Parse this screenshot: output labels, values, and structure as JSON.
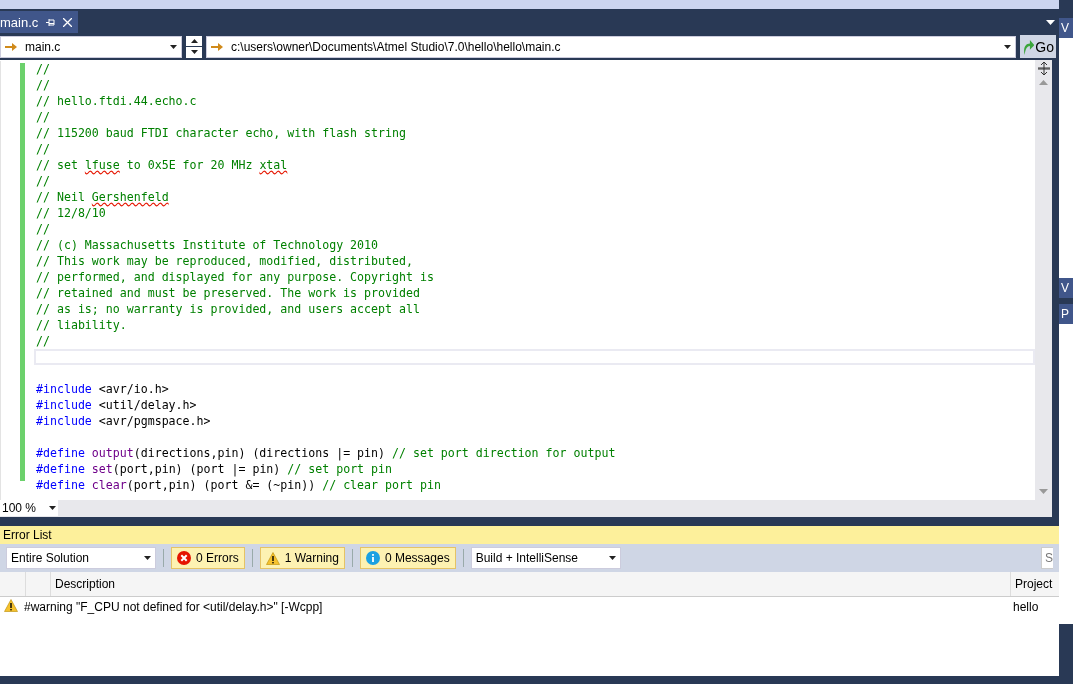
{
  "tab": {
    "label": "main.c",
    "selected": true
  },
  "nav": {
    "file": "main.c",
    "path": "c:\\users\\owner\\Documents\\Atmel Studio\\7.0\\hello\\hello\\main.c",
    "go": "Go"
  },
  "editor": {
    "blocks": [
      {
        "current_line_after": true,
        "lines": [
          [
            {
              "t": "//",
              "kind": "comment"
            }
          ],
          [
            {
              "t": "//",
              "kind": "comment"
            }
          ],
          [
            {
              "t": "// hello.ftdi.44.echo.c",
              "kind": "comment"
            }
          ],
          [
            {
              "t": "//",
              "kind": "comment"
            }
          ],
          [
            {
              "t": "// 115200 baud FTDI character echo, with flash string",
              "kind": "comment"
            }
          ],
          [
            {
              "t": "//",
              "kind": "comment"
            }
          ],
          [
            {
              "t": "// set ",
              "kind": "comment"
            },
            {
              "t": "lfuse",
              "kind": "misspelled"
            },
            {
              "t": " to 0x5E for 20 MHz ",
              "kind": "comment"
            },
            {
              "t": "xtal",
              "kind": "misspelled"
            }
          ],
          [
            {
              "t": "//",
              "kind": "comment"
            }
          ],
          [
            {
              "t": "// Neil ",
              "kind": "comment"
            },
            {
              "t": "Gershenfeld",
              "kind": "misspelled"
            }
          ],
          [
            {
              "t": "// 12/8/10",
              "kind": "comment"
            }
          ],
          [
            {
              "t": "//",
              "kind": "comment"
            }
          ],
          [
            {
              "t": "// (c) Massachusetts Institute of Technology 2010",
              "kind": "comment"
            }
          ],
          [
            {
              "t": "// This work may be reproduced, modified, distributed,",
              "kind": "comment"
            }
          ],
          [
            {
              "t": "// performed, and displayed for any purpose. Copyright is",
              "kind": "comment"
            }
          ],
          [
            {
              "t": "// retained and must be preserved. The work is provided",
              "kind": "comment"
            }
          ],
          [
            {
              "t": "// as is; no warranty is provided, and users accept all",
              "kind": "comment"
            }
          ],
          [
            {
              "t": "// liability.",
              "kind": "comment"
            }
          ],
          [
            {
              "t": "//",
              "kind": "comment"
            }
          ]
        ]
      },
      {
        "current_line_after": false,
        "lines": [
          [
            {
              "t": "#include",
              "kind": "directive"
            },
            {
              "t": " <avr/io.h>",
              "kind": "plain"
            }
          ],
          [
            {
              "t": "#include",
              "kind": "directive"
            },
            {
              "t": " <util/delay.h>",
              "kind": "plain"
            }
          ],
          [
            {
              "t": "#include",
              "kind": "directive"
            },
            {
              "t": " <avr/pgmspace.h>",
              "kind": "plain"
            }
          ]
        ]
      },
      {
        "current_line_after": false,
        "lines": [
          [
            {
              "t": "#define ",
              "kind": "directive"
            },
            {
              "t": "output",
              "kind": "macro"
            },
            {
              "t": "(directions,pin) (directions |= pin) ",
              "kind": "plain"
            },
            {
              "t": "// set port direction for output",
              "kind": "comment"
            }
          ],
          [
            {
              "t": "#define ",
              "kind": "directive"
            },
            {
              "t": "set",
              "kind": "macro"
            },
            {
              "t": "(port,pin) (port |= pin) ",
              "kind": "plain"
            },
            {
              "t": "// set port pin",
              "kind": "comment"
            }
          ],
          [
            {
              "t": "#define ",
              "kind": "directive"
            },
            {
              "t": "clear",
              "kind": "macro"
            },
            {
              "t": "(port,pin) (port &= (~pin)) ",
              "kind": "plain"
            },
            {
              "t": "// clear port pin",
              "kind": "comment"
            }
          ]
        ]
      }
    ]
  },
  "zoom": "100 %",
  "error_list": {
    "title": "Error List",
    "scope": "Entire Solution",
    "filters": [
      {
        "kind": "error",
        "label": "0 Errors",
        "selected": true
      },
      {
        "kind": "warning",
        "label": "1 Warning",
        "selected": true
      },
      {
        "kind": "message",
        "label": "0 Messages",
        "selected": true
      }
    ],
    "source": "Build + IntelliSense",
    "search_placeholder": "S",
    "columns": [
      "Description",
      "Project"
    ],
    "rows": [
      {
        "kind": "warning",
        "description": "#warning \"F_CPU not defined for <util/delay.h>\" [-Wcpp]",
        "project": "hello"
      }
    ]
  },
  "side_panel": {
    "top_tab": "V",
    "middle_tab": "V",
    "lower_tab": "P"
  }
}
